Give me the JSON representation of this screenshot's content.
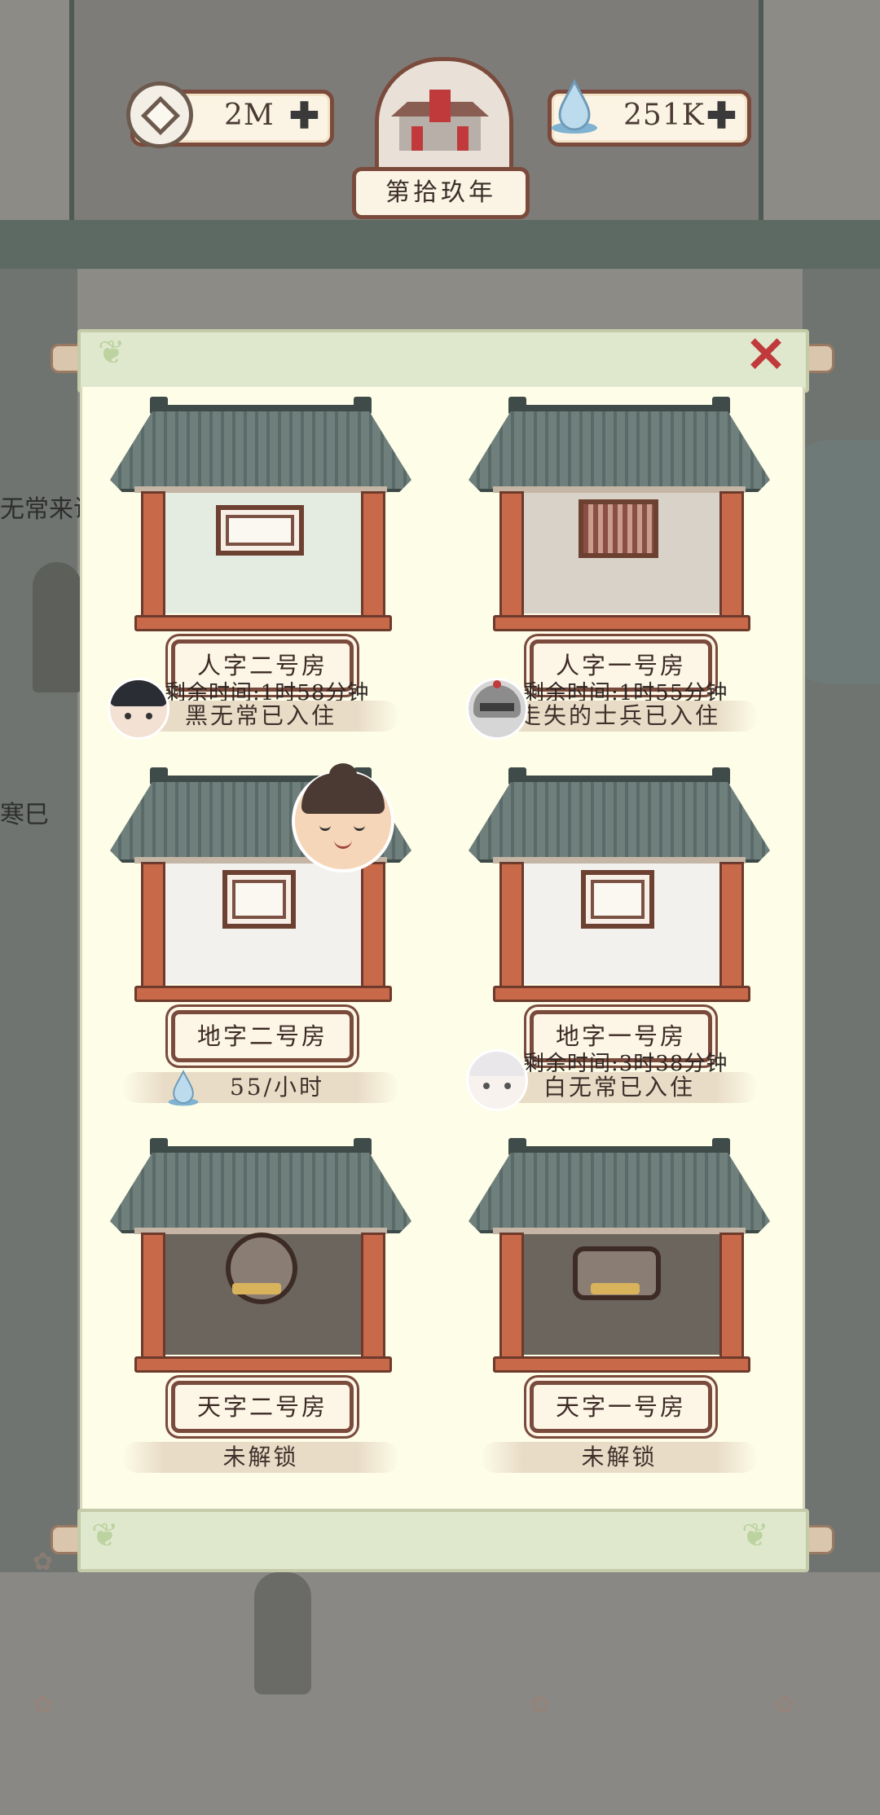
{
  "hud": {
    "coins": "2M",
    "essence": "251K",
    "plus_symbol": "✚",
    "year_label": "第拾玖年"
  },
  "colors": {
    "panel_bg": "#fdfde8",
    "wood": "#7a4b3c",
    "pillar": "#c86a4a",
    "roof": "#6f7f7c",
    "close": "#c0393b"
  },
  "background": {
    "left_text_1": "无常来访",
    "left_text_2": "寒巳"
  },
  "rooms": [
    {
      "name": "人字二号房",
      "interior": "#e4ece2",
      "timer": "剩余时间:1时58分钟",
      "status": "黑无常已入住",
      "avatar": "black-impermanence-avatar"
    },
    {
      "name": "人字一号房",
      "interior": "#d8d2c8",
      "timer": "剩余时间:1时55分钟",
      "status": "走失的士兵已入住",
      "avatar": "soldier-helmet-avatar"
    },
    {
      "name": "地字二号房",
      "interior": "#f3f1ee",
      "rate": "55/小时"
    },
    {
      "name": "地字一号房",
      "interior": "#f3f1ee",
      "timer": "剩余时间:3时38分钟",
      "status": "白无常已入住",
      "avatar": "white-impermanence-avatar"
    },
    {
      "name": "天字二号房",
      "interior": "#6b655e",
      "status": "未解锁"
    },
    {
      "name": "天字一号房",
      "interior": "#6b655e",
      "status": "未解锁"
    }
  ]
}
